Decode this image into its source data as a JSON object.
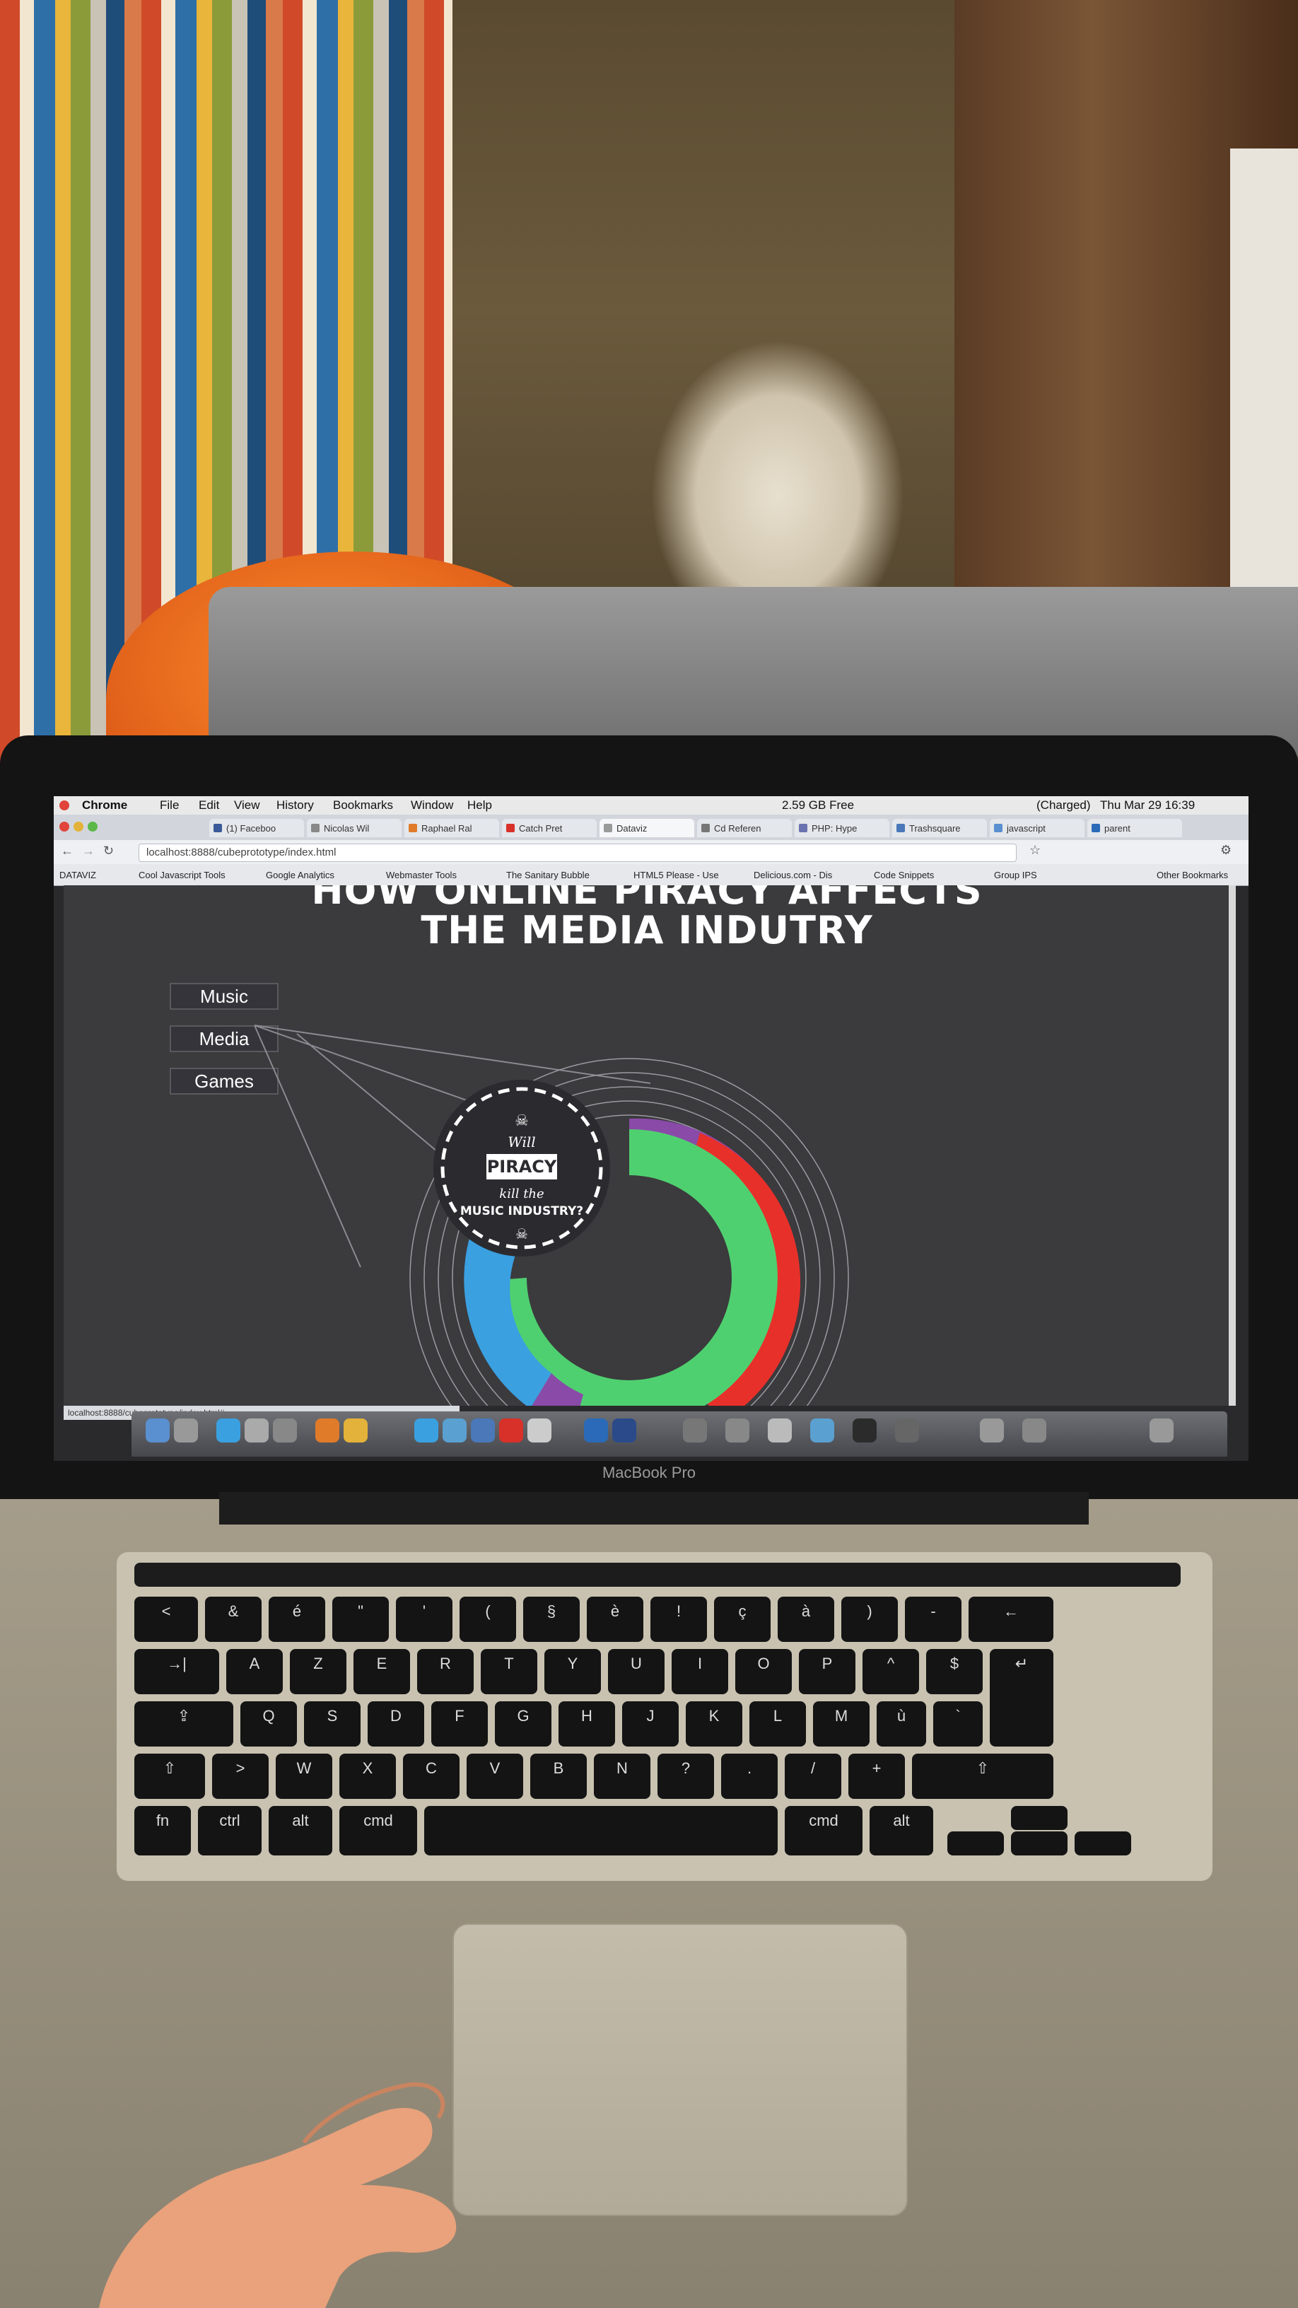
{
  "scene": {
    "laptop_brand": "MacBook Pro"
  },
  "mac_menubar": {
    "app": "Chrome",
    "menus": [
      "File",
      "Edit",
      "View",
      "History",
      "Bookmarks",
      "Window",
      "Help"
    ],
    "free_space": "2.59 GB Free",
    "battery": "(Charged)",
    "datetime": "Thu Mar 29  16:39"
  },
  "browser": {
    "tabs": [
      {
        "label": "(1) Faceboo",
        "color": "#3b5998"
      },
      {
        "label": "Nicolas Wil",
        "color": "#888888"
      },
      {
        "label": "Raphael Ral",
        "color": "#e07b2a"
      },
      {
        "label": "Catch Pret",
        "color": "#d8312a"
      },
      {
        "label": "Dataviz",
        "color": "#9a9a9a"
      },
      {
        "label": "Cd Referen",
        "color": "#777777"
      },
      {
        "label": "PHP: Hype",
        "color": "#6a73b0"
      },
      {
        "label": "Trashsquare",
        "color": "#4a78b8"
      },
      {
        "label": "javascript",
        "color": "#5a8fd0"
      },
      {
        "label": "parent",
        "color": "#2a6ab8"
      }
    ],
    "url": "localhost:8888/cubeprototype/index.html",
    "bookmarks": [
      "DATAVIZ",
      "Cool Javascript Tools",
      "Google Analytics",
      "Webmaster Tools",
      "The Sanitary Bubble",
      "HTML5 Please - Use",
      "Delicious.com - Dis",
      "Code Snippets",
      "Group IPS",
      "Other Bookmarks"
    ],
    "status_url": "localhost:8888/cubeprototype/index.html#"
  },
  "page": {
    "title_line1": "HOW ONLINE PIRACY AFFECTS",
    "title_line2": "THE MEDIA INDUTRY",
    "nav": [
      "Music",
      "Media",
      "Games"
    ],
    "badge": {
      "line1": "Will",
      "line2": "PIRACY",
      "line3": "kill the",
      "line4": "MUSIC INDUSTRY?"
    },
    "colors": {
      "green": "#4fd070",
      "red": "#e8302a",
      "blue": "#3aa0e0",
      "purple": "#8a4aa8",
      "badge_bg": "#2b2b2f"
    }
  },
  "keyboard": {
    "row1": [
      "<",
      "&",
      "é",
      "\"",
      "'",
      "(",
      "§",
      "è",
      "!",
      "ç",
      "à",
      ")",
      "-",
      "←"
    ],
    "row2": [
      "→|",
      "A",
      "Z",
      "E",
      "R",
      "T",
      "Y",
      "U",
      "I",
      "O",
      "P",
      "^",
      "$",
      "↵"
    ],
    "row3": [
      "⇪",
      "Q",
      "S",
      "D",
      "F",
      "G",
      "H",
      "J",
      "K",
      "L",
      "M",
      "ù",
      "`"
    ],
    "row4": [
      "⇧",
      ">",
      "W",
      "X",
      "C",
      "V",
      "B",
      "N",
      "?",
      ".",
      "/",
      "+",
      "⇧"
    ],
    "row5": [
      "fn",
      "ctrl",
      "alt",
      "cmd",
      "",
      "cmd",
      "alt"
    ]
  }
}
